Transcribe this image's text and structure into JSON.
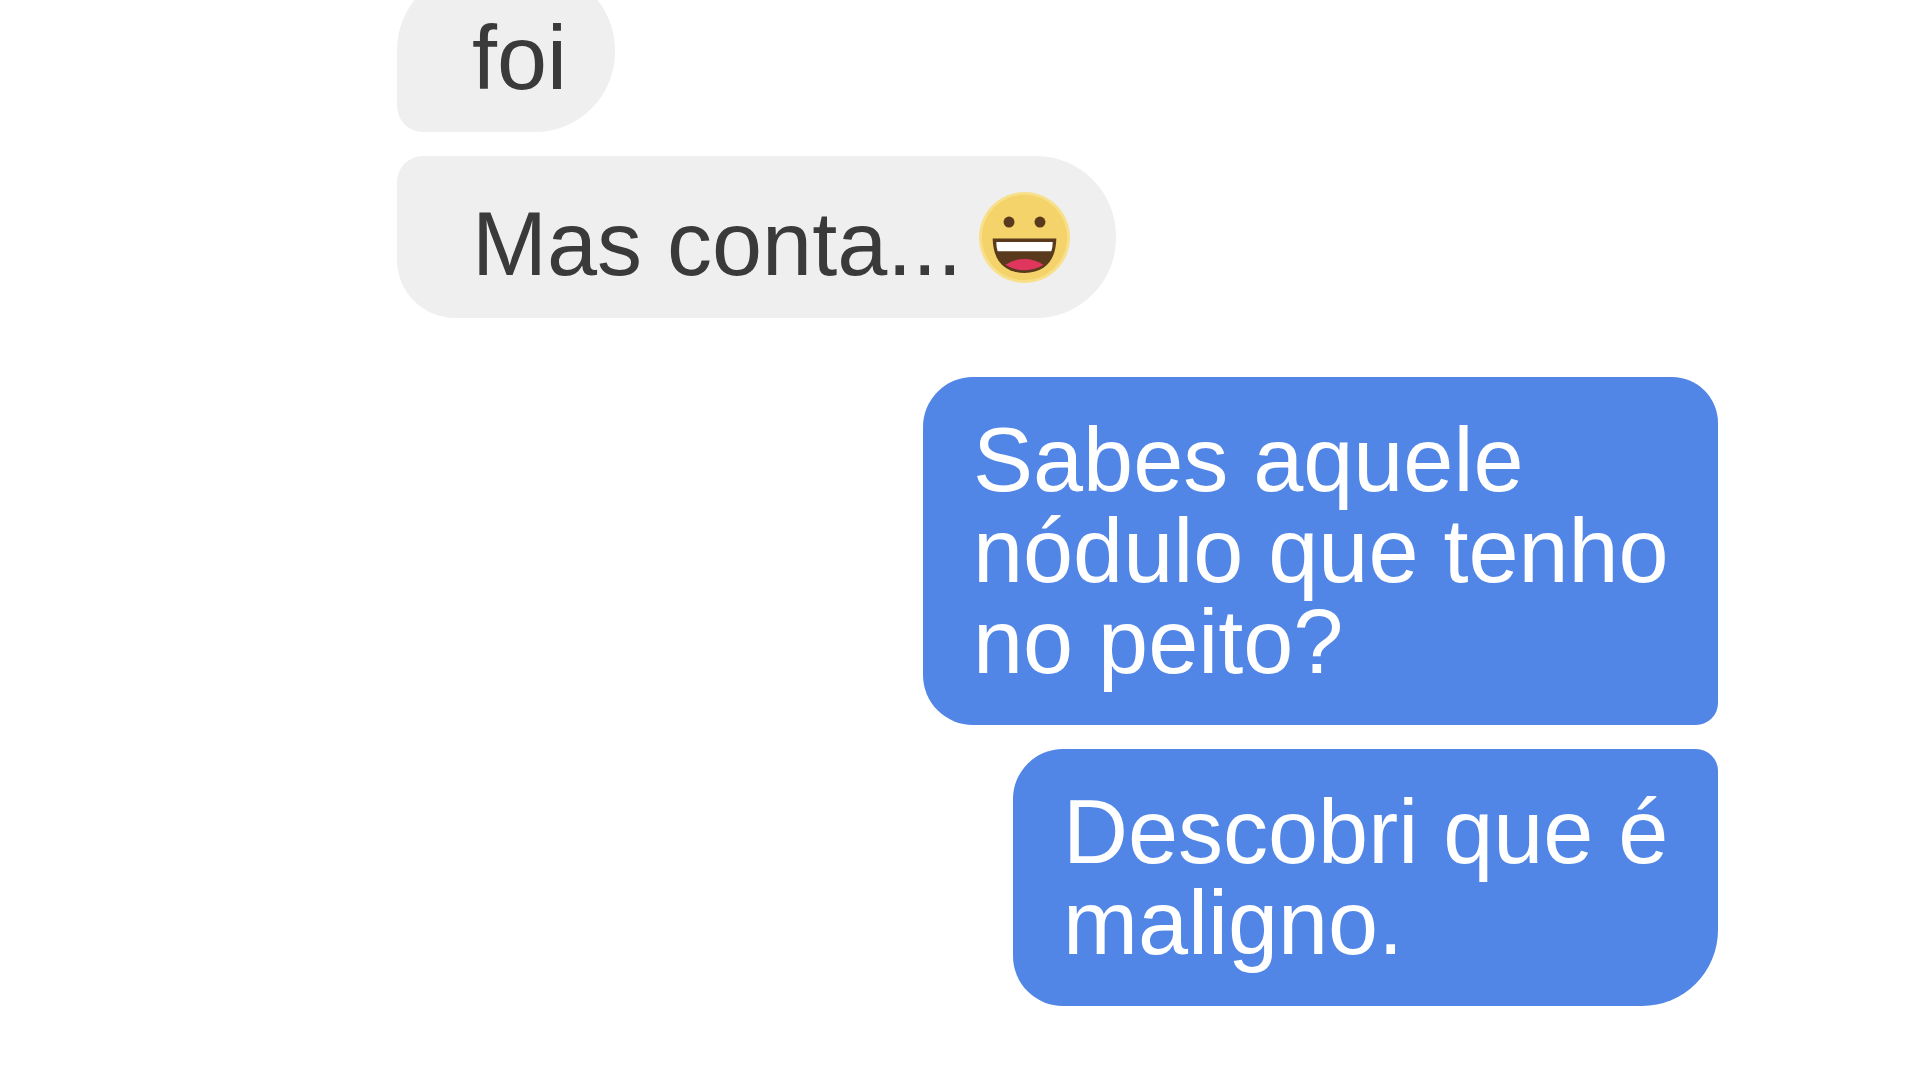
{
  "messages": [
    {
      "kind": "received",
      "text": "foi",
      "emoji": false
    },
    {
      "kind": "received",
      "text": "Mas conta...",
      "emoji": true
    },
    {
      "kind": "sent",
      "text": "Sabes aquele nódulo que tenho no peito?",
      "emoji": false
    },
    {
      "kind": "sent",
      "text": "Descobri que é maligno.",
      "emoji": false
    }
  ]
}
